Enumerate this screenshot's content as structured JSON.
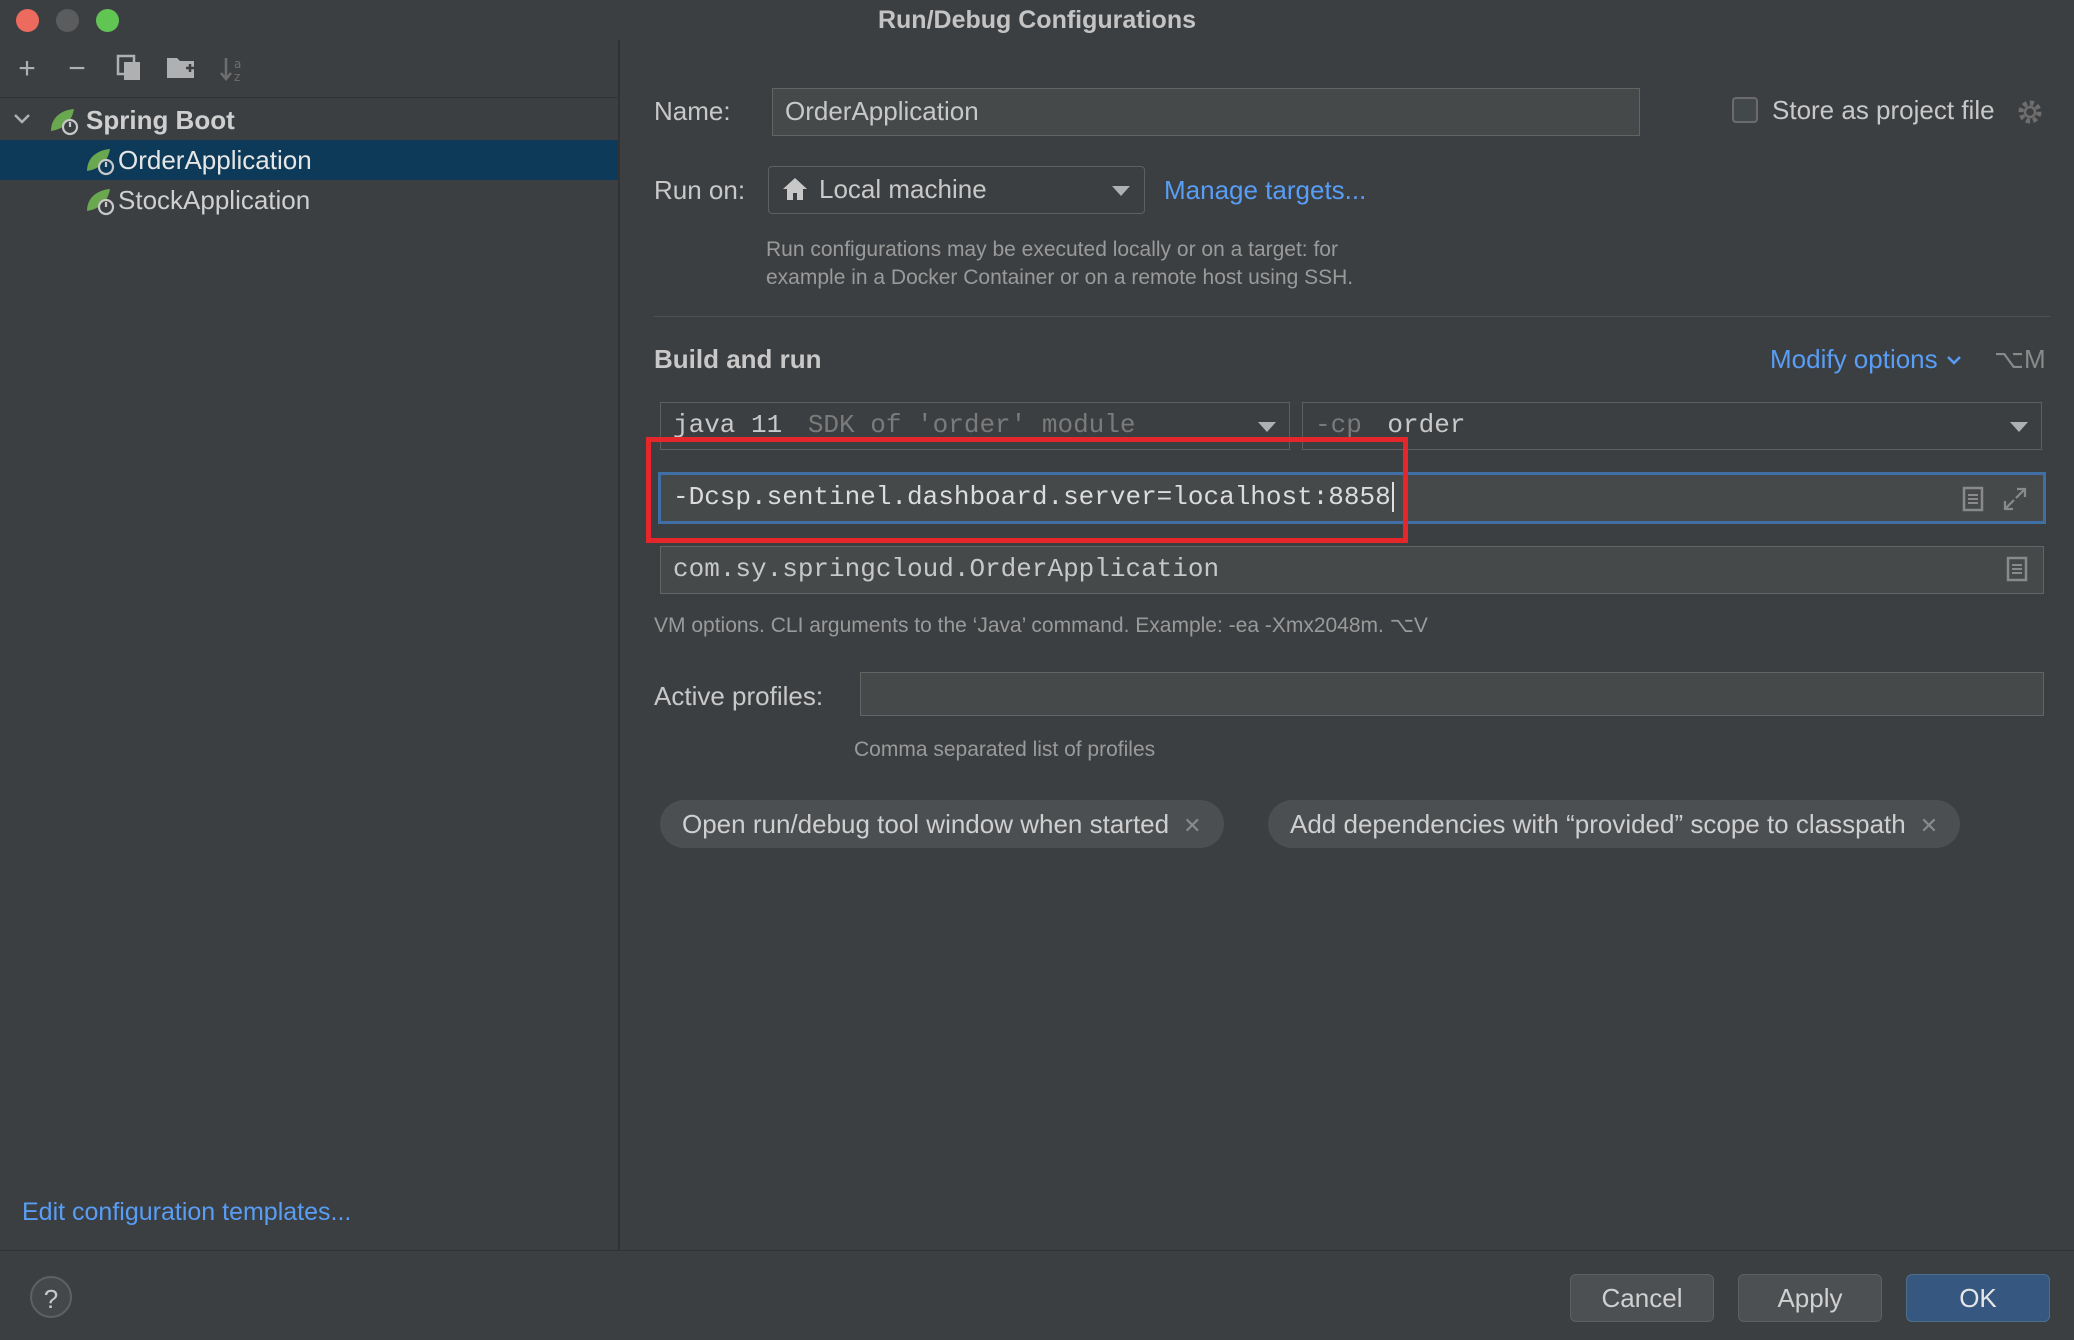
{
  "window": {
    "title": "Run/Debug Configurations"
  },
  "tree": {
    "group_label": "Spring Boot",
    "items": [
      {
        "label": "OrderApplication",
        "selected": true
      },
      {
        "label": "StockApplication",
        "selected": false
      }
    ]
  },
  "left_footer": {
    "edit_templates": "Edit configuration templates..."
  },
  "form": {
    "name_label": "Name:",
    "name_value": "OrderApplication",
    "store_label": "Store as project file",
    "run_on_label": "Run on:",
    "run_on_value": "Local machine",
    "manage_targets": "Manage targets...",
    "run_hint_line1": "Run configurations may be executed locally or on a target: for",
    "run_hint_line2": "example in a Docker Container or on a remote host using SSH.",
    "build_title": "Build and run",
    "modify_options": "Modify options",
    "modify_shortcut": "⌥M",
    "jdk_value": "java 11",
    "jdk_hint": "SDK of 'order' module",
    "cp_prefix": "-cp",
    "cp_value": "order",
    "vm_options_value": "-Dcsp.sentinel.dashboard.server=localhost:8858",
    "main_class_value": "com.sy.springcloud.OrderApplication",
    "vm_hint": "VM options. CLI arguments to the ‘Java’ command. Example: -ea -Xmx2048m. ⌥V",
    "profiles_label": "Active profiles:",
    "profiles_value": "",
    "profiles_hint": "Comma separated list of profiles",
    "chips": [
      "Open run/debug tool window when started",
      "Add dependencies with “provided” scope to classpath"
    ]
  },
  "buttons": {
    "cancel": "Cancel",
    "apply": "Apply",
    "ok": "OK",
    "help": "?"
  },
  "colors": {
    "accent": "#589df6",
    "selection": "#0d3a58",
    "highlight": "#e5262a",
    "ok_button": "#365880"
  },
  "icons": [
    "add-icon",
    "remove-icon",
    "copy-icon",
    "new-folder-icon",
    "sort-icon",
    "spring-boot-icon",
    "home-icon",
    "gear-icon",
    "clipboard-icon",
    "expand-icon",
    "close-icon",
    "chevron-down-icon"
  ]
}
